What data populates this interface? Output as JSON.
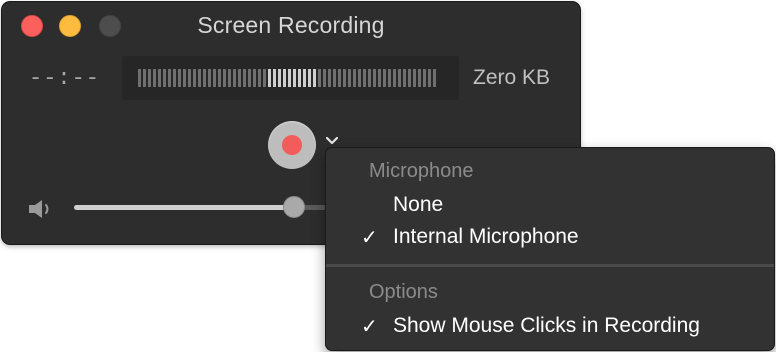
{
  "window": {
    "title": "Screen Recording",
    "time_display": "--:--",
    "file_size": "Zero KB",
    "audio_meter_lit_bars": [
      26,
      27,
      28,
      29,
      30,
      31,
      32,
      33,
      34,
      35
    ],
    "volume_fraction": 0.86
  },
  "menu": {
    "sections": [
      {
        "header": "Microphone",
        "items": [
          {
            "label": "None",
            "checked": false
          },
          {
            "label": "Internal Microphone",
            "checked": true
          }
        ]
      },
      {
        "header": "Options",
        "items": [
          {
            "label": "Show Mouse Clicks in Recording",
            "checked": true
          }
        ]
      }
    ],
    "check_glyph": "✓"
  },
  "colors": {
    "close": "#fc605c",
    "minimize": "#fdbc40",
    "record": "#f25c5a"
  }
}
